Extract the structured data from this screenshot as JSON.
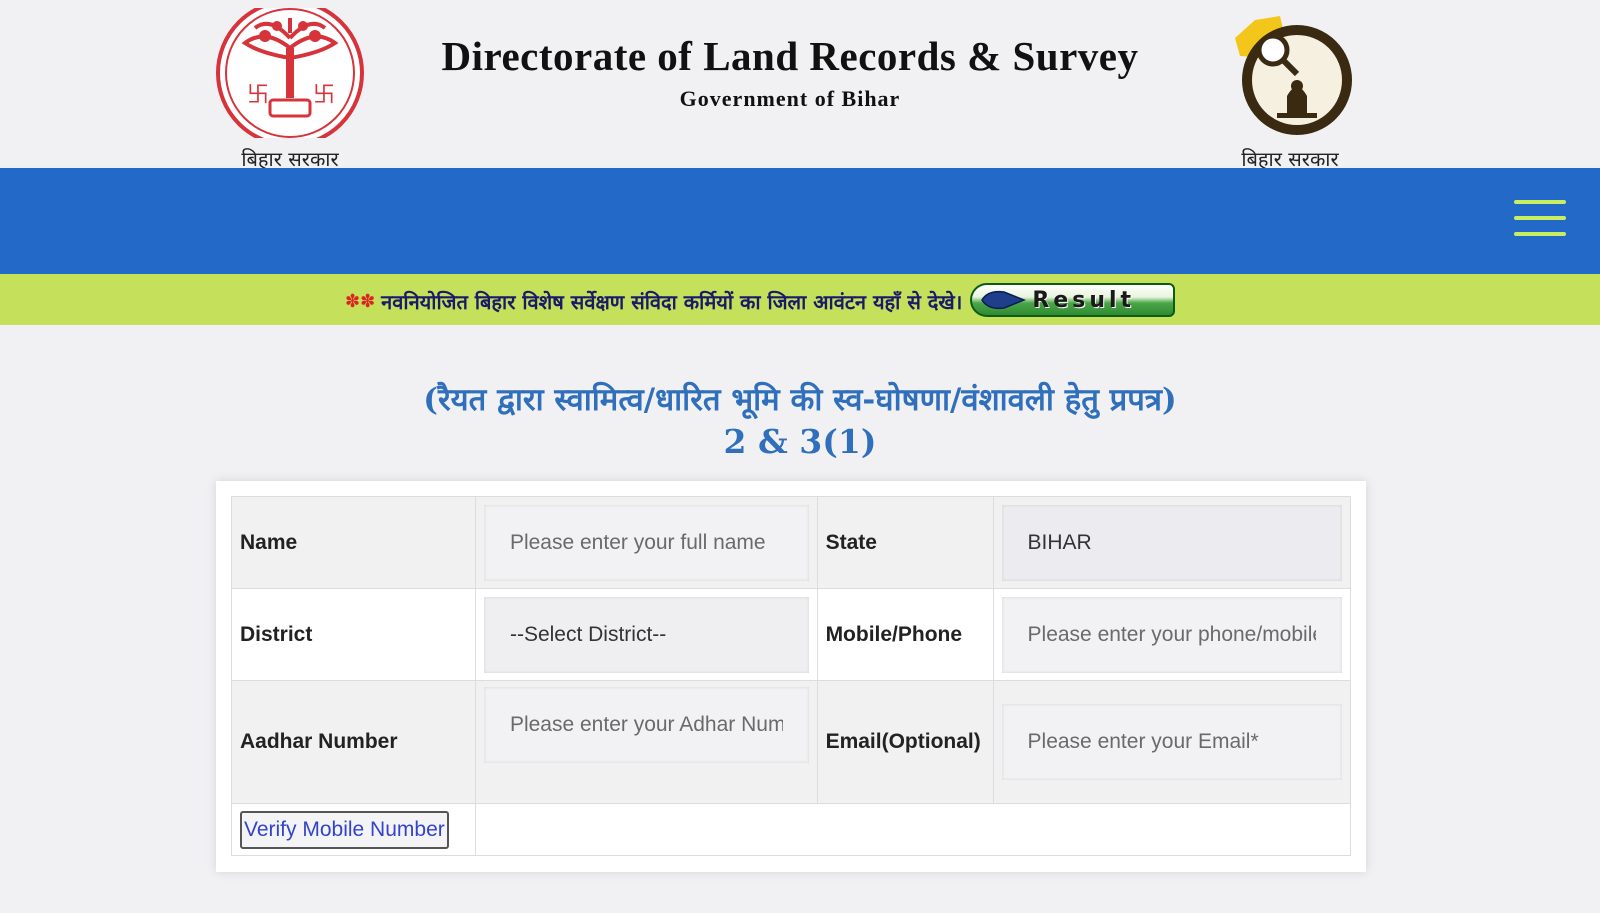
{
  "header": {
    "title": "Directorate of Land Records & Survey",
    "subtitle": "Government of Bihar",
    "logo_left_caption": "बिहार सरकार",
    "logo_right_caption": "बिहार सरकार"
  },
  "ticker": {
    "text": "नवनियोजित बिहार विशेष सर्वेक्षण संविदा कर्मियों का जिला आवंटन यहाँ से देखे।",
    "result_label": "Result"
  },
  "form": {
    "heading_line1": "(रैयत द्वारा स्वामित्व/धारित भूमि की स्व-घोषणा/वंशावली हेतु प्रपत्र)",
    "heading_line2": "2 & 3(1)",
    "name_label": "Name",
    "name_placeholder": "Please enter your full name",
    "state_label": "State",
    "state_value": "BIHAR",
    "district_label": "District",
    "district_value": "--Select District--",
    "mobile_label": "Mobile/Phone",
    "mobile_placeholder": "Please enter your phone/mobile",
    "aadhar_label": "Aadhar Number",
    "aadhar_placeholder": "Please enter your Adhar Number",
    "email_label": "Email(Optional)",
    "email_placeholder": "Please enter your Email*",
    "verify_button": "Verify Mobile Number"
  },
  "colors": {
    "nav_blue": "#2369c8",
    "ticker_green": "#c5e05a",
    "heading_blue": "#2f6fbc",
    "hamburger_lime": "#c8ef64"
  },
  "icons": [
    "bihar-emblem-icon",
    "survey-logo-icon",
    "hamburger-menu-icon",
    "flag-icon",
    "arrow-icon"
  ]
}
